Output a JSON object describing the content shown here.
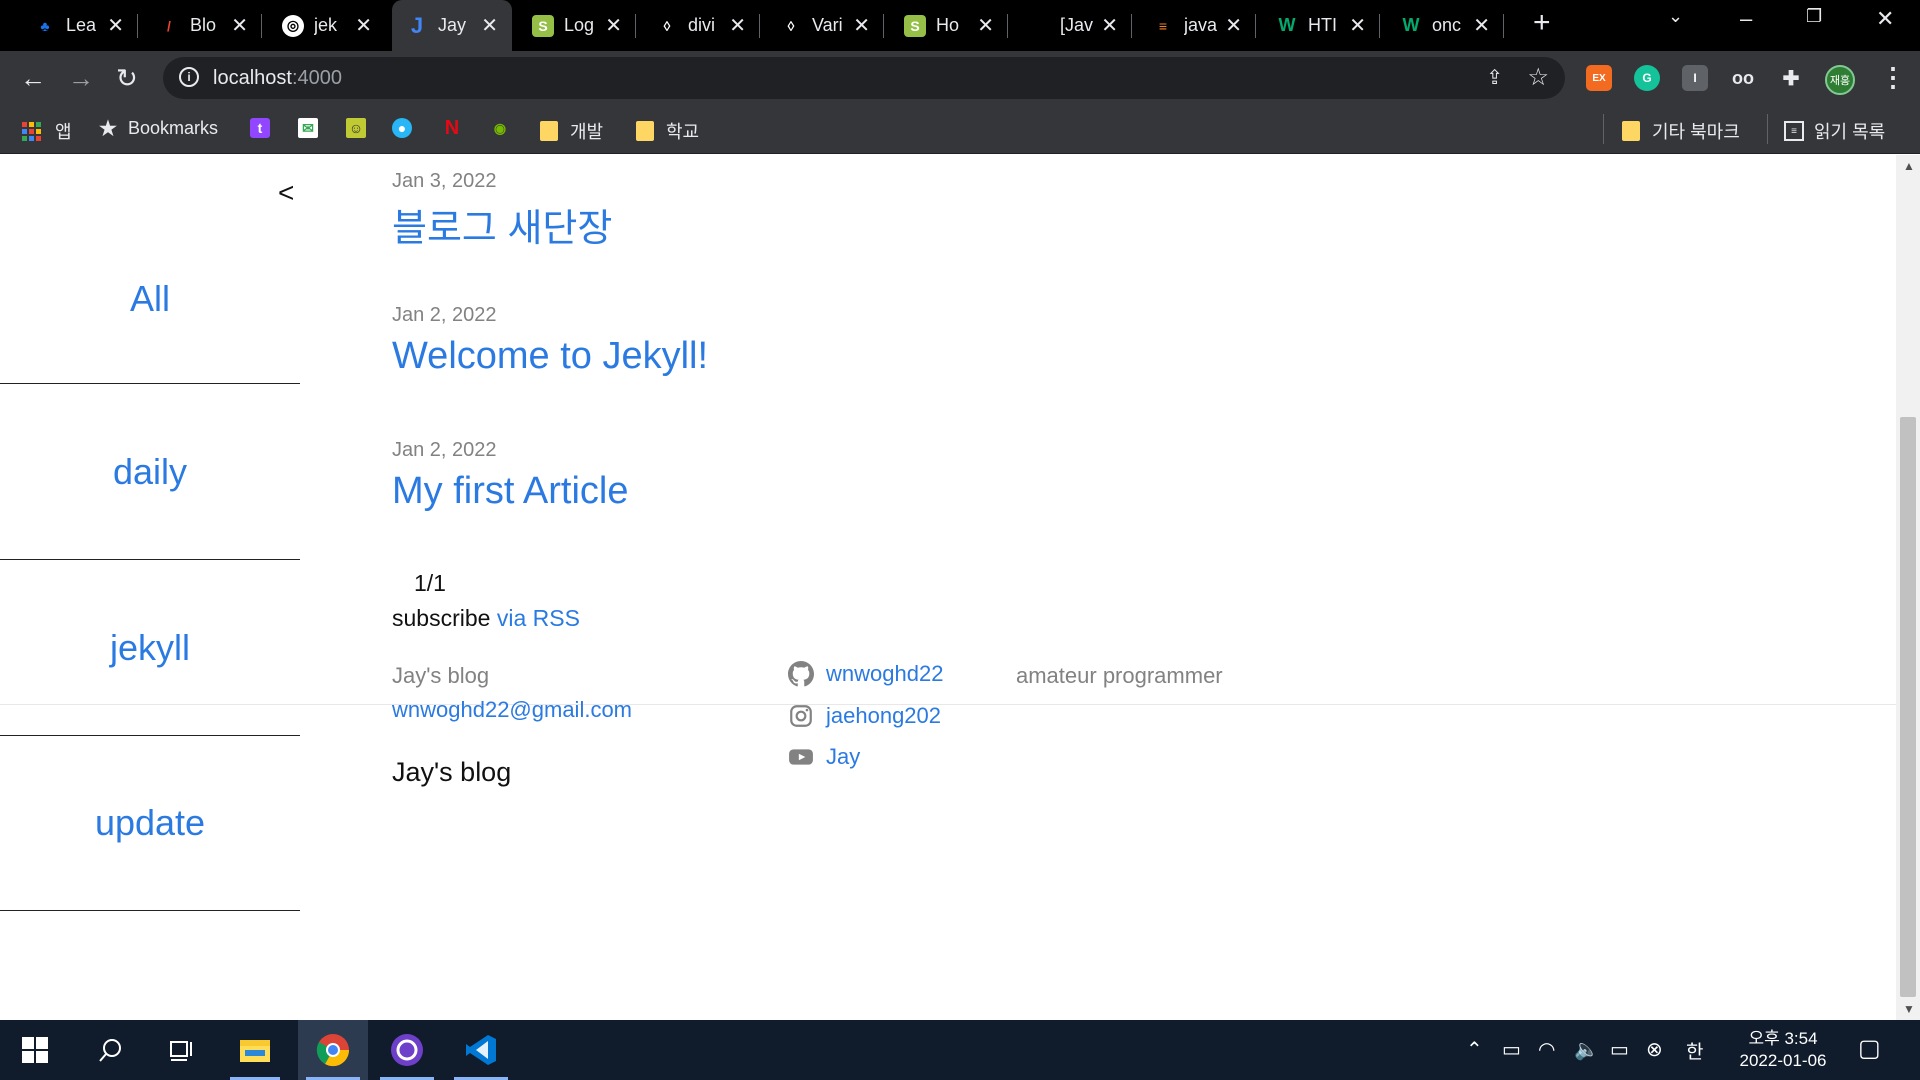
{
  "browser": {
    "tabs": [
      {
        "title": "Lea",
        "icon": "learn-icon",
        "color": "#1a73e8"
      },
      {
        "title": "Blo",
        "icon": "blog-pen-icon",
        "color": "#ea4335"
      },
      {
        "title": "jek",
        "icon": "globe-icon",
        "color": "#ffffff"
      },
      {
        "title": "Jay",
        "icon": "jekyll-j-icon",
        "color": "#4285f4"
      },
      {
        "title": "Log",
        "icon": "shopify-icon",
        "color": "#95bf47"
      },
      {
        "title": "divi",
        "icon": "drop-icon",
        "color": "#ffffff"
      },
      {
        "title": "Vari",
        "icon": "drop-icon",
        "color": "#ffffff"
      },
      {
        "title": "Ho",
        "icon": "shopify-icon",
        "color": "#95bf47"
      },
      {
        "title": "[Jav",
        "icon": "blank-icon",
        "color": "#000000"
      },
      {
        "title": "java",
        "icon": "stackoverflow-icon",
        "color": "#f48024"
      },
      {
        "title": "HTI",
        "icon": "w3schools-icon",
        "color": "#04aa6d"
      },
      {
        "title": "onc",
        "icon": "w3schools-icon",
        "color": "#04aa6d"
      }
    ],
    "url_host": "localhost",
    "url_port": ":4000",
    "bookmarks": {
      "apps_label": "앱",
      "bookmarks_label": "Bookmarks",
      "folder_dev": "개발",
      "folder_school": "학교",
      "other_bookmarks": "기타 북마크",
      "reading_list": "읽기 목록"
    },
    "profile_initials": "재홍",
    "extension_ex_label": "EX"
  },
  "sidebar": {
    "toggle": "<",
    "items": [
      "All",
      "daily",
      "jekyll",
      "update"
    ]
  },
  "posts": [
    {
      "date": "Jan 3, 2022",
      "title": "블로그 새단장"
    },
    {
      "date": "Jan 2, 2022",
      "title": "Welcome to Jekyll!"
    },
    {
      "date": "Jan 2, 2022",
      "title": "My first Article"
    }
  ],
  "pagination": "1/1",
  "subscribe": {
    "text": "subscribe",
    "link": "via RSS"
  },
  "footer": {
    "heading": "Jay's blog",
    "name": "Jay's blog",
    "email": "wnwoghd22@gmail.com",
    "github": "wnwoghd22",
    "instagram": "jaehong202",
    "youtube": "Jay",
    "description": "amateur programmer"
  },
  "taskbar": {
    "time": "오후 3:54",
    "date": "2022-01-06",
    "ime": "한"
  },
  "colors": {
    "link": "#2a7ae2",
    "muted": "#828282",
    "chrome_dark": "#35363a"
  }
}
